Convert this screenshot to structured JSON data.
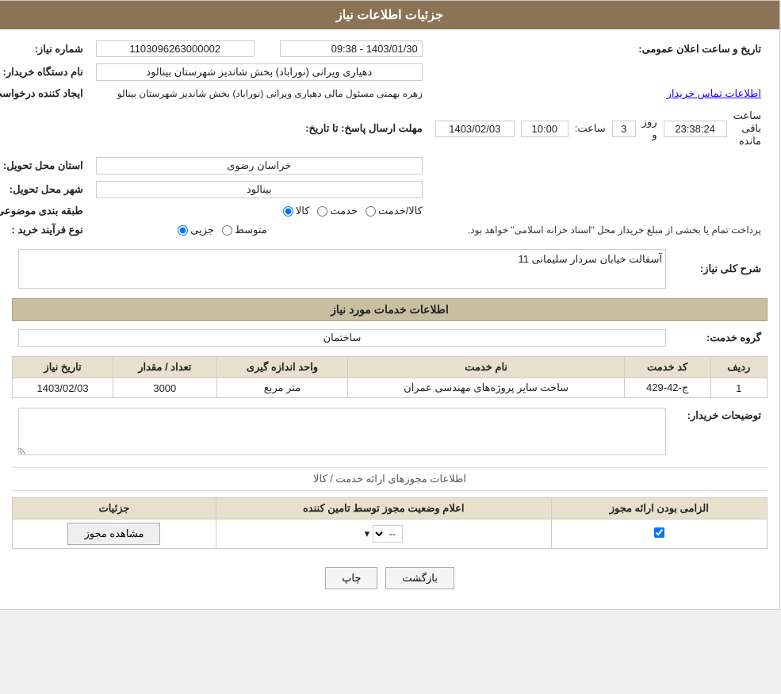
{
  "header": {
    "title": "جزئیات اطلاعات نیاز"
  },
  "fields": {
    "need_number_label": "شماره نیاز:",
    "need_number_value": "1103096263000002",
    "announcement_datetime_label": "تاریخ و ساعت اعلان عمومی:",
    "announcement_datetime_value": "1403/01/30 - 09:38",
    "buyer_name_label": "نام دستگاه خریدار:",
    "buyer_name_value": "دهیاری ویرانی (نوراباد) بخش شاندیز شهرستان بینالود",
    "requester_label": "ایجاد کننده درخواست:",
    "requester_value": "زهره بهمنی مسئول مالی دهیاری ویرانی (نوراباد) بخش شاندیز شهرستان بینالو",
    "requester_link": "اطلاعات تماس خریدار",
    "response_deadline_label": "مهلت ارسال پاسخ: تا تاریخ:",
    "response_date": "1403/02/03",
    "response_time_label": "ساعت:",
    "response_time": "10:00",
    "response_day_label": "روز و",
    "response_day": "3",
    "response_remaining_label": "ساعت باقی مانده",
    "response_remaining": "23:38:24",
    "delivery_province_label": "استان محل تحویل:",
    "delivery_province_value": "خراسان رضوی",
    "delivery_city_label": "شهر محل تحویل:",
    "delivery_city_value": "بینالود",
    "subject_label": "طبقه بندی موضوعی:",
    "subject_options": [
      "کالا",
      "خدمت",
      "کالا/خدمت"
    ],
    "subject_selected": "کالا",
    "purchase_type_label": "نوع فرآیند خرید :",
    "purchase_types": [
      "جزیی",
      "متوسط"
    ],
    "purchase_type_note": "پرداخت تمام یا بخشی از مبلغ خریدار محل \"اسناد خزانه اسلامی\" خواهد بود.",
    "need_description_label": "شرح کلی نیاز:",
    "need_description_value": "آسفالت خیابان سردار سلیمانی 11",
    "services_section_title": "اطلاعات خدمات مورد نیاز",
    "service_group_label": "گروه خدمت:",
    "service_group_value": "ساختمان",
    "table": {
      "headers": [
        "ردیف",
        "کد خدمت",
        "نام خدمت",
        "واحد اندازه گیری",
        "تعداد / مقدار",
        "تاریخ نیاز"
      ],
      "rows": [
        {
          "row": "1",
          "code": "ج-42-429",
          "name": "ساخت سایر پروژه‌های مهندسی عمران",
          "unit": "متر مربع",
          "quantity": "3000",
          "date": "1403/02/03"
        }
      ]
    },
    "buyer_desc_label": "توضیحات خریدار:",
    "buyer_desc_value": "",
    "licenses_section": "اطلاعات مجوزهای ارائه خدمت / کالا",
    "licenses_table": {
      "headers": [
        "الزامی بودن ارائه مجوز",
        "اعلام وضعیت مجوز توسط تامین کننده",
        "جزئیات"
      ],
      "rows": [
        {
          "required": true,
          "status": "--",
          "details_btn": "مشاهده مجوز"
        }
      ]
    }
  },
  "buttons": {
    "print": "چاپ",
    "back": "بازگشت"
  }
}
